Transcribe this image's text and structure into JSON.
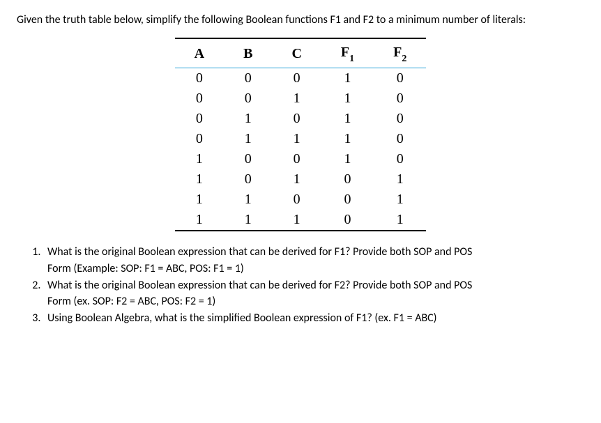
{
  "intro": "Given the truth table below, simplify the following Boolean functions F1 and F2 to a minimum number of literals:",
  "headers": {
    "A": "A",
    "B": "B",
    "C": "C",
    "F1_base": "F",
    "F1_sub": "1",
    "F2_base": "F",
    "F2_sub": "2"
  },
  "rows": [
    {
      "A": "0",
      "B": "0",
      "C": "0",
      "F1": "1",
      "F2": "0"
    },
    {
      "A": "0",
      "B": "0",
      "C": "1",
      "F1": "1",
      "F2": "0"
    },
    {
      "A": "0",
      "B": "1",
      "C": "0",
      "F1": "1",
      "F2": "0"
    },
    {
      "A": "0",
      "B": "1",
      "C": "1",
      "F1": "1",
      "F2": "0"
    },
    {
      "A": "1",
      "B": "0",
      "C": "0",
      "F1": "1",
      "F2": "0"
    },
    {
      "A": "1",
      "B": "0",
      "C": "1",
      "F1": "0",
      "F2": "1"
    },
    {
      "A": "1",
      "B": "1",
      "C": "0",
      "F1": "0",
      "F2": "1"
    },
    {
      "A": "1",
      "B": "1",
      "C": "1",
      "F1": "0",
      "F2": "1"
    }
  ],
  "questions": {
    "q1_line1": "What is the original Boolean expression that can be derived for F1? Provide both SOP and POS",
    "q1_line2": "Form (Example: SOP: F1 = ABC, POS: F1 = 1)",
    "q2_line1": "What is the original Boolean expression that can be derived for F2? Provide both SOP and POS",
    "q2_line2": "Form (ex. SOP: F2 = ABC, POS: F2 = 1)",
    "q3": "Using Boolean Algebra, what is the simplified Boolean expression of F1? (ex. F1 = ABC)"
  }
}
